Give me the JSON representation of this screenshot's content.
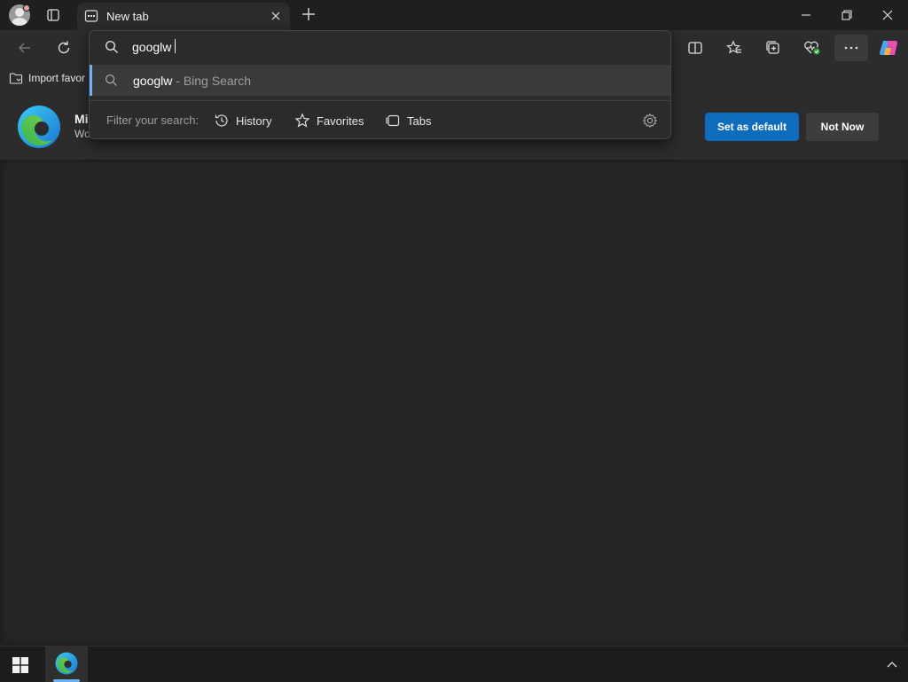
{
  "window": {
    "tab_title": "New tab"
  },
  "favorites_bar": {
    "import_label": "Import favor"
  },
  "banner": {
    "title": "Mi",
    "subtitle": "Wo",
    "set_default_label": "Set as default",
    "not_now_label": "Not Now"
  },
  "address_dropdown": {
    "query": "googlw",
    "suggestion": {
      "text": "googlw",
      "meta": " - Bing Search"
    },
    "filter_label": "Filter your search:",
    "filters": [
      {
        "label": "History",
        "icon": "history-icon"
      },
      {
        "label": "Favorites",
        "icon": "star-icon"
      },
      {
        "label": "Tabs",
        "icon": "tabs-icon"
      }
    ]
  },
  "colors": {
    "accent": "#0f6cbd",
    "selection_bar": "#6ab0f3",
    "background": "#1f1f1f"
  }
}
